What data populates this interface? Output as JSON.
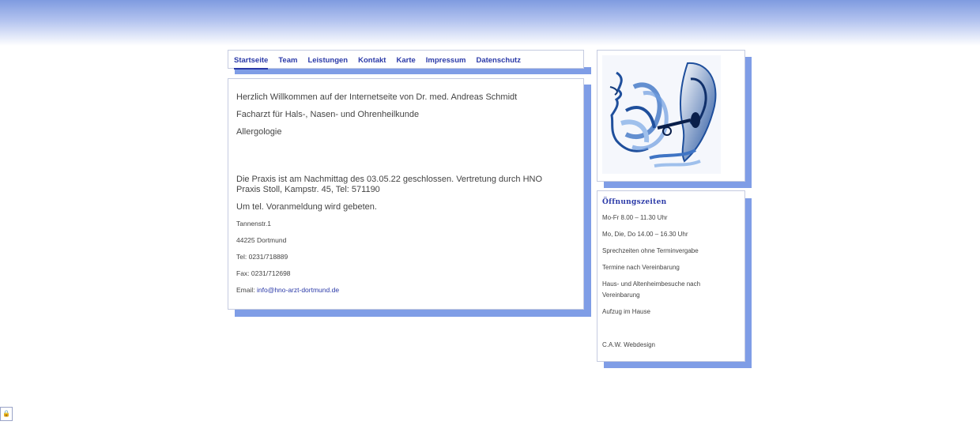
{
  "nav": {
    "items": [
      {
        "label": "Startseite",
        "active": true
      },
      {
        "label": "Team"
      },
      {
        "label": "Leistungen"
      },
      {
        "label": "Kontakt"
      },
      {
        "label": "Karte"
      },
      {
        "label": "Impressum"
      },
      {
        "label": "Datenschutz"
      }
    ]
  },
  "main": {
    "welcome": "Herzlich Willkommen auf der Internetseite von Dr. med. Andreas Schmidt",
    "specialty": "Facharzt für Hals-, Nasen- und Ohrenheilkunde",
    "subspecialty": "Allergologie",
    "notice": "Die Praxis ist am Nachmittag des 03.05.22 geschlossen. Vertretung durch HNO Praxis Stoll, Kampstr. 45, Tel: 571190",
    "appointment_note": "Um tel. Voranmeldung wird gebeten.",
    "street": "Tannenstr.1",
    "city": "44225 Dortmund",
    "phone": "Tel: 0231/718889",
    "fax": "Fax: 0231/712698",
    "email_label": "Email: ",
    "email": "info@hno-arzt-dortmund.de"
  },
  "hours": {
    "title": "Öffnungszeiten",
    "lines": [
      "Mo-Fr 8.00 – 11.30 Uhr",
      "Mo, Die, Do 14.00 – 16.30 Uhr",
      "Sprechzeiten ohne Terminvergabe",
      "Termine nach Vereinbarung",
      "Haus- und Altenheimbesuche nach Vereinbarung",
      "Aufzug im Hause"
    ],
    "credit": "C.A.W. Webdesign"
  },
  "icons": {
    "logo": "ear-face-illustration-icon",
    "lock": "lock-icon"
  },
  "colors": {
    "accent": "#2b3aa8",
    "shadow": "#7f9de6"
  }
}
